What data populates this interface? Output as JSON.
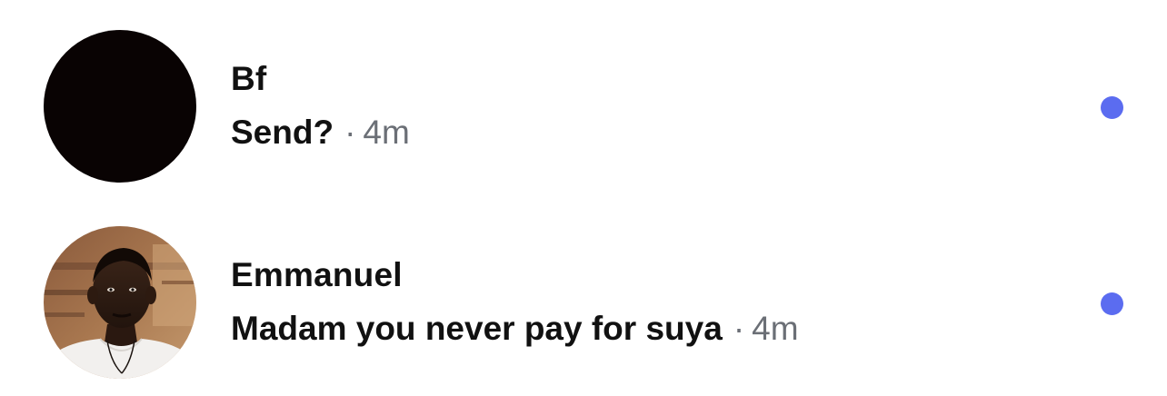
{
  "colors": {
    "background": "#ffffff",
    "name_text": "#111111",
    "meta_text": "#6b6f76",
    "unread_dot": "#5b6cf0"
  },
  "conversations": [
    {
      "name": "Bf",
      "preview": "Send?",
      "separator": "·",
      "time": "4m",
      "avatar": "dark-photo-avatar",
      "unread": true
    },
    {
      "name": "Emmanuel",
      "preview": "Madam you never pay for suya",
      "separator": "·",
      "time": "4m",
      "avatar": "profile-photo-avatar",
      "unread": true
    }
  ]
}
